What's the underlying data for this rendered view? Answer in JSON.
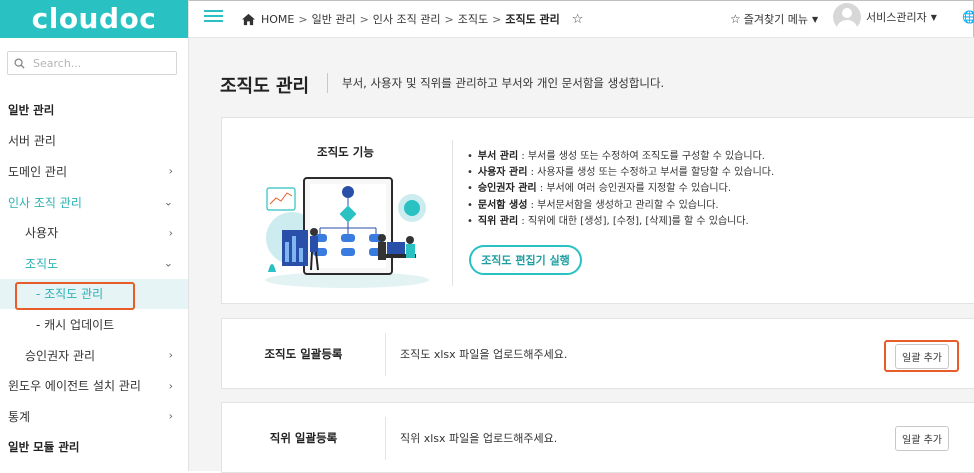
{
  "app": {
    "logo": "cloudoc"
  },
  "search": {
    "placeholder": "Search..."
  },
  "sidebar": {
    "sections": [
      {
        "title": "일반 관리"
      },
      {
        "title": "일반 모듈 관리"
      }
    ],
    "items": [
      {
        "label": "서버 관리"
      },
      {
        "label": "도메인 관리"
      },
      {
        "label": "인사 조직 관리"
      },
      {
        "label": "사용자"
      },
      {
        "label": "조직도"
      },
      {
        "label": "- 조직도 관리"
      },
      {
        "label": "- 캐시 업데이트"
      },
      {
        "label": "승인권자 관리"
      },
      {
        "label": "윈도우 에이전트 설치 관리"
      },
      {
        "label": "통계"
      }
    ]
  },
  "header": {
    "breadcrumb": [
      "HOME",
      "일반 관리",
      "인사 조직 관리",
      "조직도",
      "조직도 관리"
    ],
    "favorites_label": "즐겨찾기 메뉴",
    "user_label": "서비스관리자"
  },
  "page": {
    "title": "조직도 관리",
    "description": "부서, 사용자 및 직위를 관리하고 부서와 개인 문서함을 생성합니다."
  },
  "features": {
    "title": "조직도 기능",
    "items": [
      {
        "name": "부서 관리",
        "desc": " : 부서를 생성 또는 수정하여 조직도를 구성할 수 있습니다."
      },
      {
        "name": "사용자 관리",
        "desc": " : 사용자를 생성 또는 수정하고 부서를 할당할 수 있습니다."
      },
      {
        "name": "승인권자 관리",
        "desc": " : 부서에 여러 승인권자를 지정할 수 있습니다."
      },
      {
        "name": "문서함 생성",
        "desc": " : 부서문서함을 생성하고 관리할 수 있습니다."
      },
      {
        "name": "직위 관리",
        "desc": " : 직위에 대한 [생성], [수정], [삭제]를 할 수 있습니다."
      }
    ],
    "editor_button": "조직도 편집기 실행"
  },
  "bulk_org": {
    "label": "조직도 일괄등록",
    "desc": "조직도 xlsx 파일을 업로드해주세요.",
    "button": "일괄 추가"
  },
  "bulk_position": {
    "label": "직위 일괄등록",
    "desc": "직위 xlsx 파일을 업로드해주세요.",
    "button": "일괄 추가"
  },
  "colors": {
    "brand": "#2ac1c3",
    "highlight": "#e85c2a",
    "active_bg": "#e6f4f5"
  }
}
